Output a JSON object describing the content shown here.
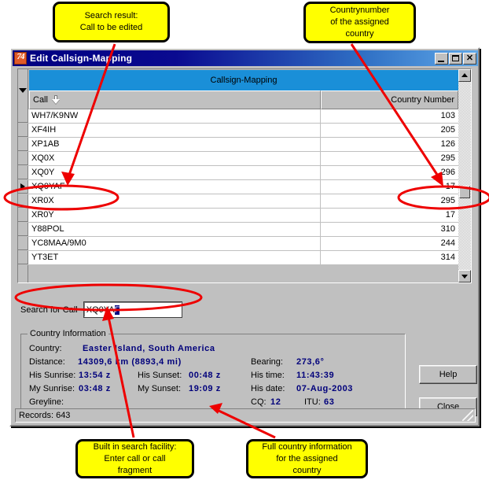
{
  "window": {
    "title": "Edit Callsign-Mapping",
    "icon": "app-icon-74",
    "icon_glyph": "74",
    "minimize_label": "",
    "maximize_label": "",
    "close_label": "✕"
  },
  "grid": {
    "band_title": "Callsign-Mapping",
    "columns": [
      "Call",
      "Country Number"
    ],
    "sort_indicator": "descending-arrow",
    "rows": [
      {
        "call": "WH7/K9NW",
        "country_number": "103",
        "current": false
      },
      {
        "call": "XF4IH",
        "country_number": "205",
        "current": false
      },
      {
        "call": "XP1AB",
        "country_number": "126",
        "current": false
      },
      {
        "call": "XQ0X",
        "country_number": "295",
        "current": false
      },
      {
        "call": "XQ0Y",
        "country_number": "296",
        "current": false
      },
      {
        "call": "XQ0YAF",
        "country_number": "17",
        "current": true
      },
      {
        "call": "XR0X",
        "country_number": "295",
        "current": false
      },
      {
        "call": "XR0Y",
        "country_number": "17",
        "current": false
      },
      {
        "call": "Y88POL",
        "country_number": "310",
        "current": false
      },
      {
        "call": "YC8MAA/9M0",
        "country_number": "244",
        "current": false
      },
      {
        "call": "YT3ET",
        "country_number": "314",
        "current": false
      }
    ]
  },
  "search": {
    "label": "Search for Call",
    "value_typed": "XQ0YA",
    "value_selected": "F"
  },
  "country_information": {
    "legend": "Country Information",
    "country_label": "Country:",
    "country_value": "Easter Island, South America",
    "distance_label": "Distance:",
    "distance_value": "14309,6 km   (8893,4 mi)",
    "his_sunrise_label": "His Sunrise:",
    "his_sunrise_value": "13:54  z",
    "his_sunset_label": "His Sunset:",
    "his_sunset_value": "00:48  z",
    "my_sunrise_label": "My Sunrise:",
    "my_sunrise_value": "03:48  z",
    "my_sunset_label": "My Sunset:",
    "my_sunset_value": "19:09  z",
    "greyline_label": "Greyline:",
    "greyline_value": "",
    "bearing_label": "Bearing:",
    "bearing_value": "273,6°",
    "his_time_label": "His time:",
    "his_time_value": "11:43:39",
    "his_date_label": "His date:",
    "his_date_value": "07-Aug-2003",
    "cq_label": "CQ:",
    "cq_value": "12",
    "itu_label": "ITU:",
    "itu_value": "63"
  },
  "buttons": {
    "help": "Help",
    "close": "Close"
  },
  "statusbar": {
    "records": "Records: 643"
  },
  "annotations": {
    "search_result": {
      "line1": "Search result:",
      "line2": "",
      "line3": "Call to be edited"
    },
    "country_number": {
      "line1": "Countrynumber",
      "line2": "of the assigned",
      "line3": "country"
    },
    "builtin_search": {
      "line1": "Built in search facility:",
      "line2": "Enter call or call",
      "line3": "fragment"
    },
    "full_info": {
      "line1": "Full country information",
      "line2": "for the assigned",
      "line3": "country"
    }
  },
  "colors": {
    "annotation_fill": "#ffff00",
    "annotation_stroke": "#000000",
    "marker_red": "#ee0000",
    "value_blue": "#00007b",
    "band_blue": "#1a8fd8",
    "window_face": "#c0c0c0"
  }
}
